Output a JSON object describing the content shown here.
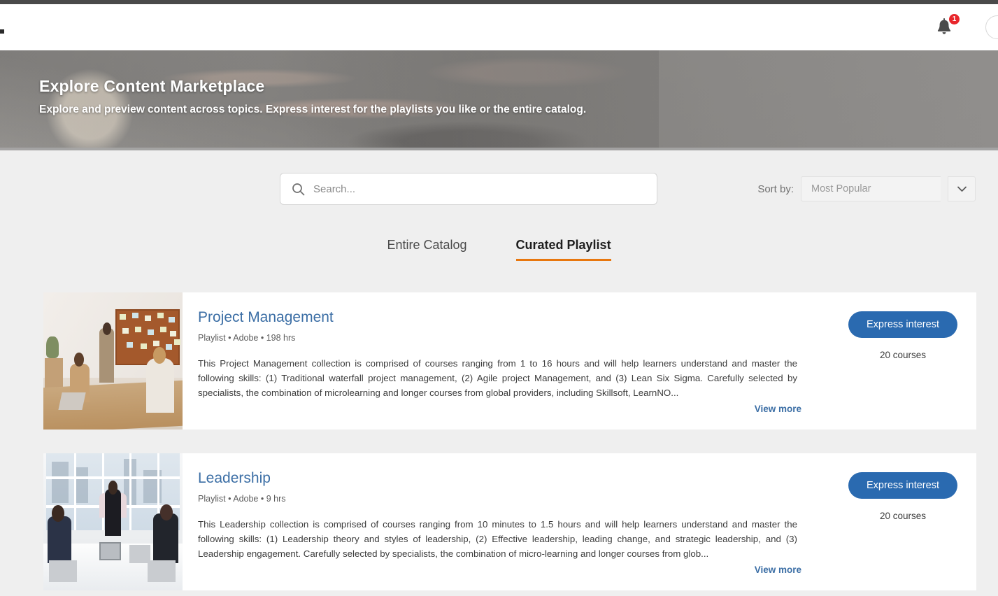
{
  "header": {
    "notification_count": "1",
    "bell_icon": "bell-icon",
    "avatar": "user-avatar"
  },
  "hero": {
    "title": "Explore Content Marketplace",
    "subtitle": "Explore and preview content across topics. Express interest for the playlists you like or the entire catalog."
  },
  "search": {
    "placeholder": "Search...",
    "value": "",
    "icon": "search-icon"
  },
  "sort": {
    "label": "Sort by:",
    "selected": "Most Popular",
    "caret_icon": "chevron-down-icon"
  },
  "tabs": [
    {
      "label": "Entire Catalog",
      "active": false
    },
    {
      "label": "Curated Playlist",
      "active": true
    }
  ],
  "cards": [
    {
      "title": "Project Management",
      "meta": "Playlist • Adobe • 198 hrs",
      "description": "This Project Management collection is comprised of courses ranging from 1 to 16 hours and will help learners understand and master the following skills: (1) Traditional waterfall project management, (2) Agile project Management, and (3) Lean Six Sigma. Carefully selected by specialists, the combination of microlearning and longer courses from global providers, including Skillsoft, LearnNO...",
      "view_more": "View more",
      "button_label": "Express interest",
      "course_count": "20 courses",
      "thumbnail": "office-meeting-corkboard-photo"
    },
    {
      "title": "Leadership",
      "meta": "Playlist • Adobe • 9 hrs",
      "description": "This Leadership collection is comprised of courses ranging from 10 minutes to 1.5 hours and will help learners understand and master the following skills: (1) Leadership theory and styles of leadership, (2) Effective leadership, leading change, and strategic leadership, and (3) Leadership engagement. Carefully selected by specialists, the combination of micro-learning and longer courses from glob...",
      "view_more": "View more",
      "button_label": "Express interest",
      "course_count": "20 courses",
      "thumbnail": "conference-room-meeting-photo"
    }
  ],
  "colors": {
    "accent_orange": "#e8770e",
    "link_blue": "#3b6ea5",
    "button_blue": "#2a6ab0",
    "badge_red": "#e8262b",
    "page_background": "#efefef",
    "top_bar": "#4a4a4a"
  }
}
